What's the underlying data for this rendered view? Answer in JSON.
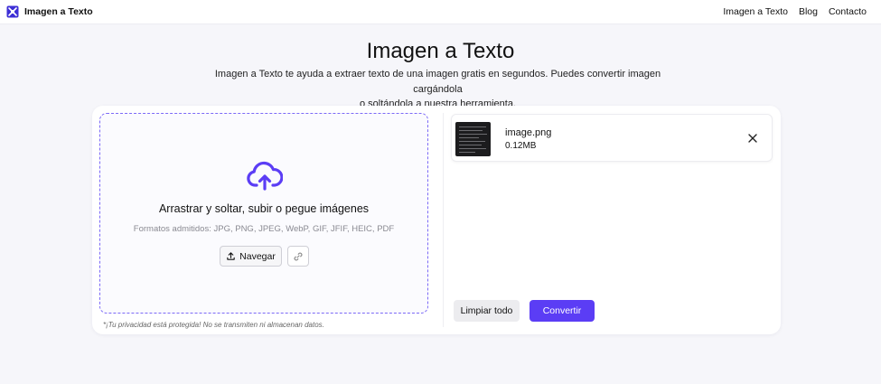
{
  "header": {
    "brand": "Imagen a Texto",
    "nav": [
      "Imagen a Texto",
      "Blog",
      "Contacto"
    ]
  },
  "hero": {
    "title": "Imagen a Texto",
    "description_line1": "Imagen a Texto te ayuda a extraer texto de una imagen gratis en segundos. Puedes convertir imagen cargándola",
    "description_line2": "o soltándola a nuestra herramienta."
  },
  "upload": {
    "title": "Arrastrar y soltar, subir o pegue imágenes",
    "formats": "Formatos admitidos: JPG, PNG, JPEG, WebP, GIF, JFIF, HEIC, PDF",
    "browse_label": "Navegar",
    "privacy_note": "*¡Tu privacidad está protegida! No se transmiten ni almacenan datos."
  },
  "files": [
    {
      "name": "image.png",
      "size": "0.12MB"
    }
  ],
  "actions": {
    "clear_label": "Limpiar todo",
    "convert_label": "Convertir"
  },
  "colors": {
    "accent": "#5b3df5",
    "dashed_border": "#7c6af7",
    "background": "#f6f6fa"
  },
  "icons": {
    "brand": "brand-logo-icon",
    "upload": "cloud-upload-icon",
    "browse": "upload-arrow-icon",
    "link": "link-icon",
    "remove": "close-icon"
  }
}
